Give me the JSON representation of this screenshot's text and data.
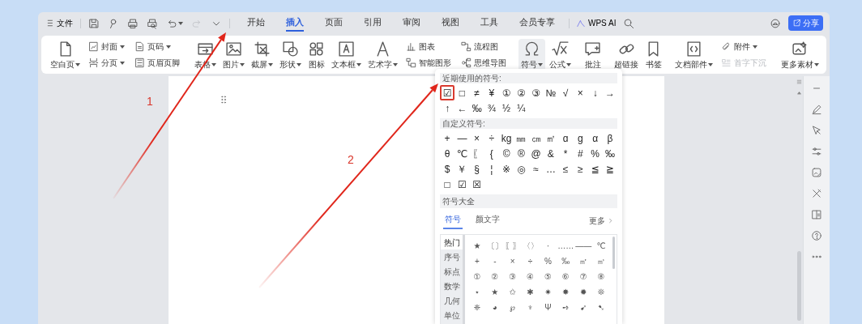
{
  "menu": {
    "label": "文件"
  },
  "quick_access": [
    {
      "dropdown": false,
      "disabled": false
    },
    {
      "dropdown": false,
      "disabled": false
    },
    {
      "dropdown": false,
      "disabled": false
    },
    {
      "dropdown": false,
      "disabled": false
    },
    {
      "dropdown": true,
      "disabled": false
    },
    {
      "dropdown": false,
      "disabled": true
    },
    {
      "dropdown": false,
      "disabled": false
    }
  ],
  "tabs": [
    {
      "label": "开始",
      "selected": false
    },
    {
      "label": "插入",
      "selected": true
    },
    {
      "label": "页面",
      "selected": false
    },
    {
      "label": "引用",
      "selected": false
    },
    {
      "label": "审阅",
      "selected": false
    },
    {
      "label": "视图",
      "selected": false
    },
    {
      "label": "工具",
      "selected": false
    },
    {
      "label": "会员专享",
      "selected": false
    }
  ],
  "ai_button": {
    "label": "WPS AI"
  },
  "share_button": {
    "label": "分享"
  },
  "ribbon": {
    "groups": [
      {
        "items": [
          {
            "kind": "large",
            "label": "空白页",
            "dropdown": true,
            "pressed": false,
            "disabled": false
          },
          {
            "kind": "stack",
            "items": [
              {
                "label": "封面",
                "dropdown": true,
                "disabled": false
              },
              {
                "label": "分页",
                "dropdown": true,
                "disabled": false
              }
            ]
          },
          {
            "kind": "stack",
            "items": [
              {
                "label": "页码",
                "dropdown": true,
                "disabled": false
              },
              {
                "label": "页眉页脚",
                "dropdown": false,
                "disabled": false
              }
            ]
          }
        ]
      },
      {
        "items": [
          {
            "kind": "large",
            "label": "表格",
            "dropdown": true,
            "pressed": false,
            "disabled": false
          },
          {
            "kind": "large",
            "label": "图片",
            "dropdown": true,
            "pressed": false,
            "disabled": false
          },
          {
            "kind": "large",
            "label": "截屏",
            "dropdown": true,
            "pressed": false,
            "disabled": false
          },
          {
            "kind": "large",
            "label": "形状",
            "dropdown": true,
            "pressed": false,
            "disabled": false
          },
          {
            "kind": "large",
            "label": "图标",
            "dropdown": false,
            "pressed": false,
            "disabled": false
          },
          {
            "kind": "large",
            "label": "文本框",
            "dropdown": true,
            "pressed": false,
            "disabled": false
          },
          {
            "kind": "large",
            "label": "艺术字",
            "dropdown": true,
            "pressed": false,
            "disabled": false
          },
          {
            "kind": "stack",
            "items": [
              {
                "label": "图表",
                "dropdown": false,
                "disabled": false
              },
              {
                "label": "智能图形",
                "dropdown": false,
                "disabled": false
              }
            ]
          },
          {
            "kind": "stack",
            "items": [
              {
                "label": "流程图",
                "dropdown": false,
                "disabled": false
              },
              {
                "label": "思维导图",
                "dropdown": false,
                "disabled": false
              }
            ]
          }
        ]
      },
      {
        "items": [
          {
            "kind": "large",
            "label": "符号",
            "dropdown": true,
            "pressed": true,
            "disabled": false
          },
          {
            "kind": "large",
            "label": "公式",
            "dropdown": true,
            "pressed": false,
            "disabled": false
          }
        ]
      },
      {
        "items": [
          {
            "kind": "large",
            "label": "批注",
            "dropdown": false,
            "pressed": false,
            "disabled": false
          }
        ]
      },
      {
        "items": [
          {
            "kind": "large",
            "label": "超链接",
            "dropdown": false,
            "pressed": false,
            "disabled": false
          },
          {
            "kind": "large",
            "label": "书签",
            "dropdown": false,
            "pressed": false,
            "disabled": false
          }
        ]
      },
      {
        "items": [
          {
            "kind": "large",
            "label": "文档部件",
            "dropdown": true,
            "pressed": false,
            "disabled": false
          },
          {
            "kind": "stack",
            "items": [
              {
                "label": "附件",
                "dropdown": true,
                "disabled": false
              },
              {
                "label": "首字下沉",
                "dropdown": false,
                "disabled": true
              }
            ]
          }
        ]
      },
      {
        "items": [
          {
            "kind": "large",
            "label": "更多素材",
            "dropdown": true,
            "pressed": false,
            "disabled": false
          }
        ]
      }
    ]
  },
  "symbol_panel": {
    "recent_title": "近期使用的符号:",
    "recent": [
      {
        "symbol": "☑",
        "highlighted": true
      },
      {
        "symbol": "□",
        "highlighted": false
      },
      {
        "symbol": "≠",
        "highlighted": false
      },
      {
        "symbol": "¥",
        "highlighted": false
      },
      {
        "symbol": "①",
        "highlighted": false
      },
      {
        "symbol": "②",
        "highlighted": false
      },
      {
        "symbol": "③",
        "highlighted": false
      },
      {
        "symbol": "№",
        "highlighted": false
      },
      {
        "symbol": "√",
        "highlighted": false
      },
      {
        "symbol": "×",
        "highlighted": false
      },
      {
        "symbol": "↓",
        "highlighted": false
      },
      {
        "symbol": "→",
        "highlighted": false
      },
      {
        "symbol": "↑",
        "highlighted": false
      },
      {
        "symbol": "←",
        "highlighted": false
      },
      {
        "symbol": "‰",
        "highlighted": false
      },
      {
        "symbol": "¾",
        "highlighted": false
      },
      {
        "symbol": "½",
        "highlighted": false
      },
      {
        "symbol": "¼",
        "highlighted": false
      }
    ],
    "custom_title": "自定义符号:",
    "custom": [
      "+",
      "—",
      "×",
      "÷",
      "kg",
      "㎜",
      "㎝",
      "㎡",
      "ɑ",
      "ɡ",
      "α",
      "β",
      "θ",
      "℃",
      "〖",
      "{",
      "©",
      "®",
      "@",
      "&",
      "*",
      "#",
      "%",
      "‰",
      "$",
      "￥",
      "§",
      "¦",
      "※",
      "◎",
      "≈",
      "…",
      "≤",
      "≥",
      "≦",
      "≧",
      "□",
      "☑",
      "☒"
    ],
    "library_title": "符号大全",
    "library_tabs": [
      {
        "label": "符号",
        "selected": true
      },
      {
        "label": "颜文字",
        "selected": false
      }
    ],
    "more_link": "更多",
    "categories": [
      {
        "label": "热门",
        "selected": true
      },
      {
        "label": "序号",
        "selected": false
      },
      {
        "label": "标点",
        "selected": false
      },
      {
        "label": "数学",
        "selected": false
      },
      {
        "label": "几何",
        "selected": false
      },
      {
        "label": "单位",
        "selected": false
      }
    ],
    "symbols": [
      "★",
      "〔〕",
      "〖〗",
      "〈〉",
      "·",
      "……",
      "——",
      "℃",
      "+",
      "-",
      "×",
      "÷",
      "%",
      "‰",
      "㎡",
      "㎥",
      "①",
      "②",
      "③",
      "④",
      "⑤",
      "⑥",
      "⑦",
      "⑧",
      "⋆",
      "★",
      "✩",
      "✱",
      "✷",
      "✸",
      "✹",
      "❊",
      "❈",
      "◕",
      "℘",
      "♆",
      "Ψ",
      "➺",
      "➹",
      "➷"
    ]
  },
  "annotations": [
    {
      "label": "1"
    },
    {
      "label": "2"
    }
  ]
}
